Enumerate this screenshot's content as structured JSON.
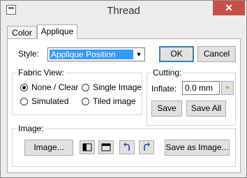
{
  "window": {
    "title": "Thread",
    "close_glyph": "✕"
  },
  "tabs": [
    {
      "label": "Color"
    },
    {
      "label": "Applique"
    }
  ],
  "style": {
    "label": "Style:",
    "selected": "Applique Position"
  },
  "buttons": {
    "ok": "OK",
    "cancel": "Cancel"
  },
  "fabric_view": {
    "title": "Fabric View:",
    "options": [
      {
        "label": "None / Clear",
        "checked": true
      },
      {
        "label": "Single Image",
        "checked": false
      },
      {
        "label": "Simulated",
        "checked": false
      },
      {
        "label": "Tiled image",
        "checked": false
      }
    ]
  },
  "cutting": {
    "title": "Cutting:",
    "inflate_label": "Inflate:",
    "inflate_value": "0.0 mm",
    "save": "Save",
    "save_all": "Save All"
  },
  "image": {
    "title": "Image:",
    "image_button": "Image...",
    "save_as_image": "Save as Image..."
  }
}
